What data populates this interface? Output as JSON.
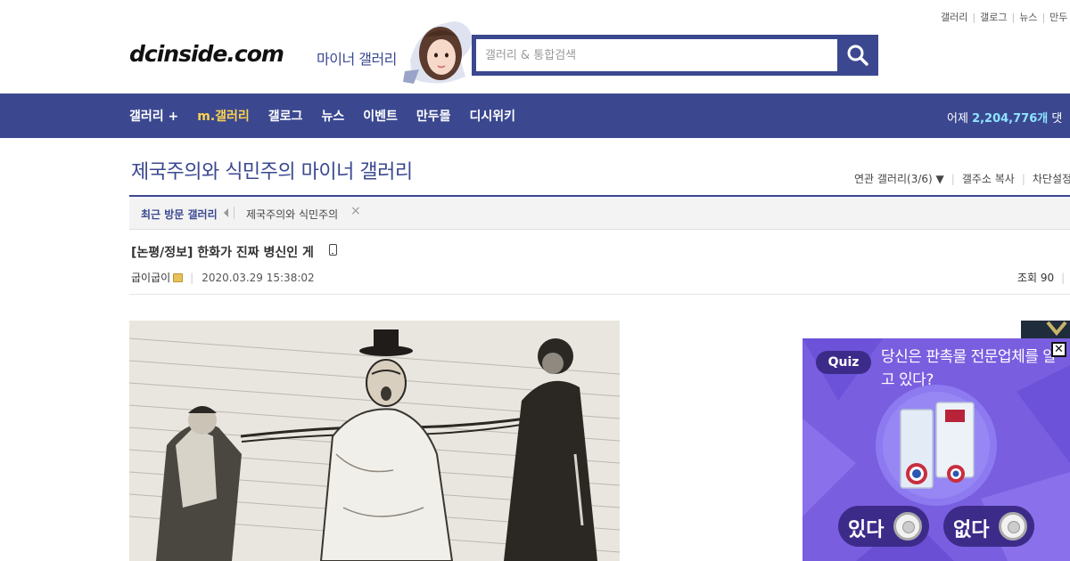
{
  "util_links": [
    "갤러리",
    "갤로그",
    "뉴스",
    "만두"
  ],
  "header": {
    "logo": "dcinside.com",
    "gallery_label": "마이너 갤러리",
    "search_placeholder": "갤러리 & 통합검색"
  },
  "nav": {
    "items": [
      {
        "label": "갤러리 +",
        "active": false
      },
      {
        "label": "m.갤러리",
        "active": true
      },
      {
        "label": "갤로그",
        "active": false
      },
      {
        "label": "뉴스",
        "active": false
      },
      {
        "label": "이벤트",
        "active": false
      },
      {
        "label": "만두몰",
        "active": false
      },
      {
        "label": "디시위키",
        "active": false
      }
    ],
    "visits_prefix": "어제 ",
    "visits_count": "2,204,776개",
    "visits_suffix": " 댓"
  },
  "gallery": {
    "title": "제국주의와 식민주의 마이너 갤러리",
    "related": "연관 갤러리(3/6)",
    "copy_address": "갤주소 복사",
    "block_settings": "차단설정"
  },
  "recent": {
    "label": "최근 방문 갤러리",
    "items": [
      "제국주의와 식민주의"
    ]
  },
  "post": {
    "title": "[논평/정보] 한화가 진짜 병신인 게",
    "author": "굽이굽이",
    "date": "2020.03.29 15:38:02",
    "views_label": "조회 90"
  },
  "quiz_ad": {
    "badge": "Quiz",
    "question": "당신은 판촉물 전문업체를 알고 있다?",
    "yes": "있다",
    "no": "없다"
  },
  "colors": {
    "brand": "#3b4890",
    "nav_active": "#fcd34d",
    "quiz_bg": "#7a5ee0"
  }
}
